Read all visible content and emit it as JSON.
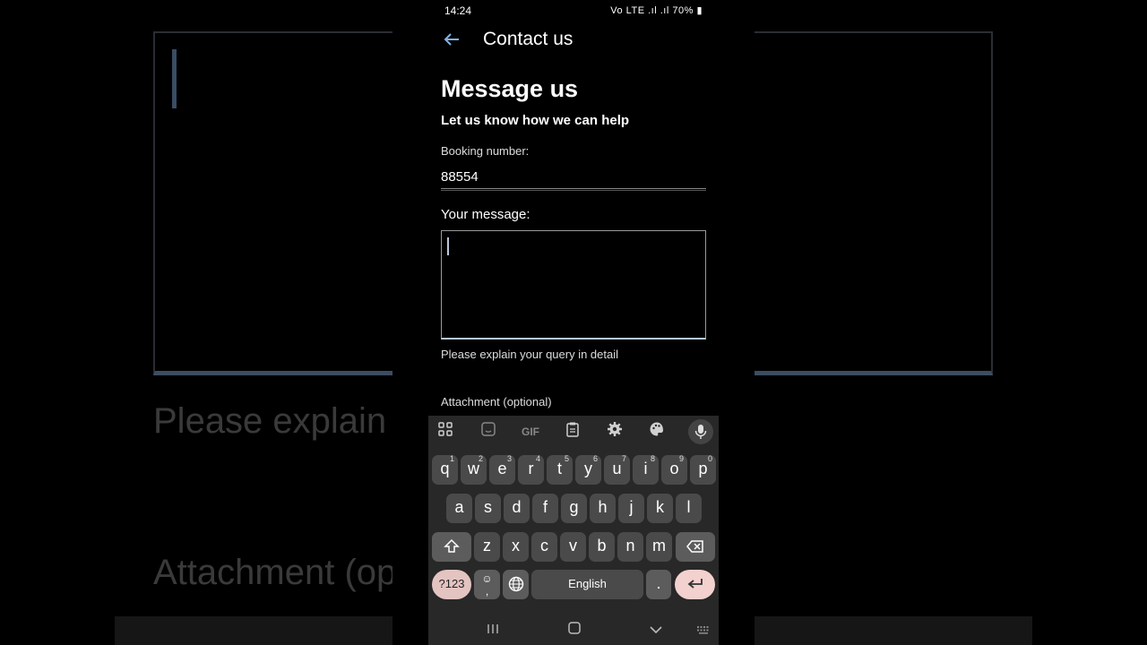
{
  "background": {
    "hint_large": "Please explain",
    "attach_large": "Attachment (op"
  },
  "status_bar": {
    "time": "14:24",
    "icons": "Vo LTE .ıl .ıl",
    "battery": "70%"
  },
  "app_bar": {
    "back_icon": "arrow-left-icon",
    "title": "Contact us"
  },
  "form": {
    "heading": "Message us",
    "subheading": "Let us know how we can help",
    "booking_label": "Booking number:",
    "booking_value": "88554",
    "message_label": "Your message:",
    "message_value": "",
    "message_hint": "Please explain your query in detail",
    "attachment_label": "Attachment (optional)"
  },
  "keyboard": {
    "toolbar": [
      "apps-grid-icon",
      "sticker-icon",
      "GIF",
      "clipboard-icon",
      "gear-icon",
      "palette-icon",
      "mic-icon"
    ],
    "row1": [
      {
        "k": "q",
        "n": "1"
      },
      {
        "k": "w",
        "n": "2"
      },
      {
        "k": "e",
        "n": "3"
      },
      {
        "k": "r",
        "n": "4"
      },
      {
        "k": "t",
        "n": "5"
      },
      {
        "k": "y",
        "n": "6"
      },
      {
        "k": "u",
        "n": "7"
      },
      {
        "k": "i",
        "n": "8"
      },
      {
        "k": "o",
        "n": "9"
      },
      {
        "k": "p",
        "n": "0"
      }
    ],
    "row2": [
      "a",
      "s",
      "d",
      "f",
      "g",
      "h",
      "j",
      "k",
      "l"
    ],
    "row3": [
      "z",
      "x",
      "c",
      "v",
      "b",
      "n",
      "m"
    ],
    "symbols_label": "?123",
    "comma_label": ",",
    "space_label": "English",
    "period_label": ".",
    "shift_icon": "shift-icon",
    "backspace_icon": "backspace-icon",
    "globe_icon": "globe-icon",
    "enter_icon": "enter-icon",
    "emoji_icon": "emoji-icon"
  },
  "nav_bar": {
    "recents_icon": "recents-icon",
    "home_icon": "home-icon",
    "hide_keyboard_icon": "chevron-down-icon",
    "keyboard_switch_icon": "keyboard-icon"
  },
  "colors": {
    "accent": "#7fb2e8",
    "enter_key": "#f2d1ce",
    "symbols_key": "#e3c4c1"
  }
}
